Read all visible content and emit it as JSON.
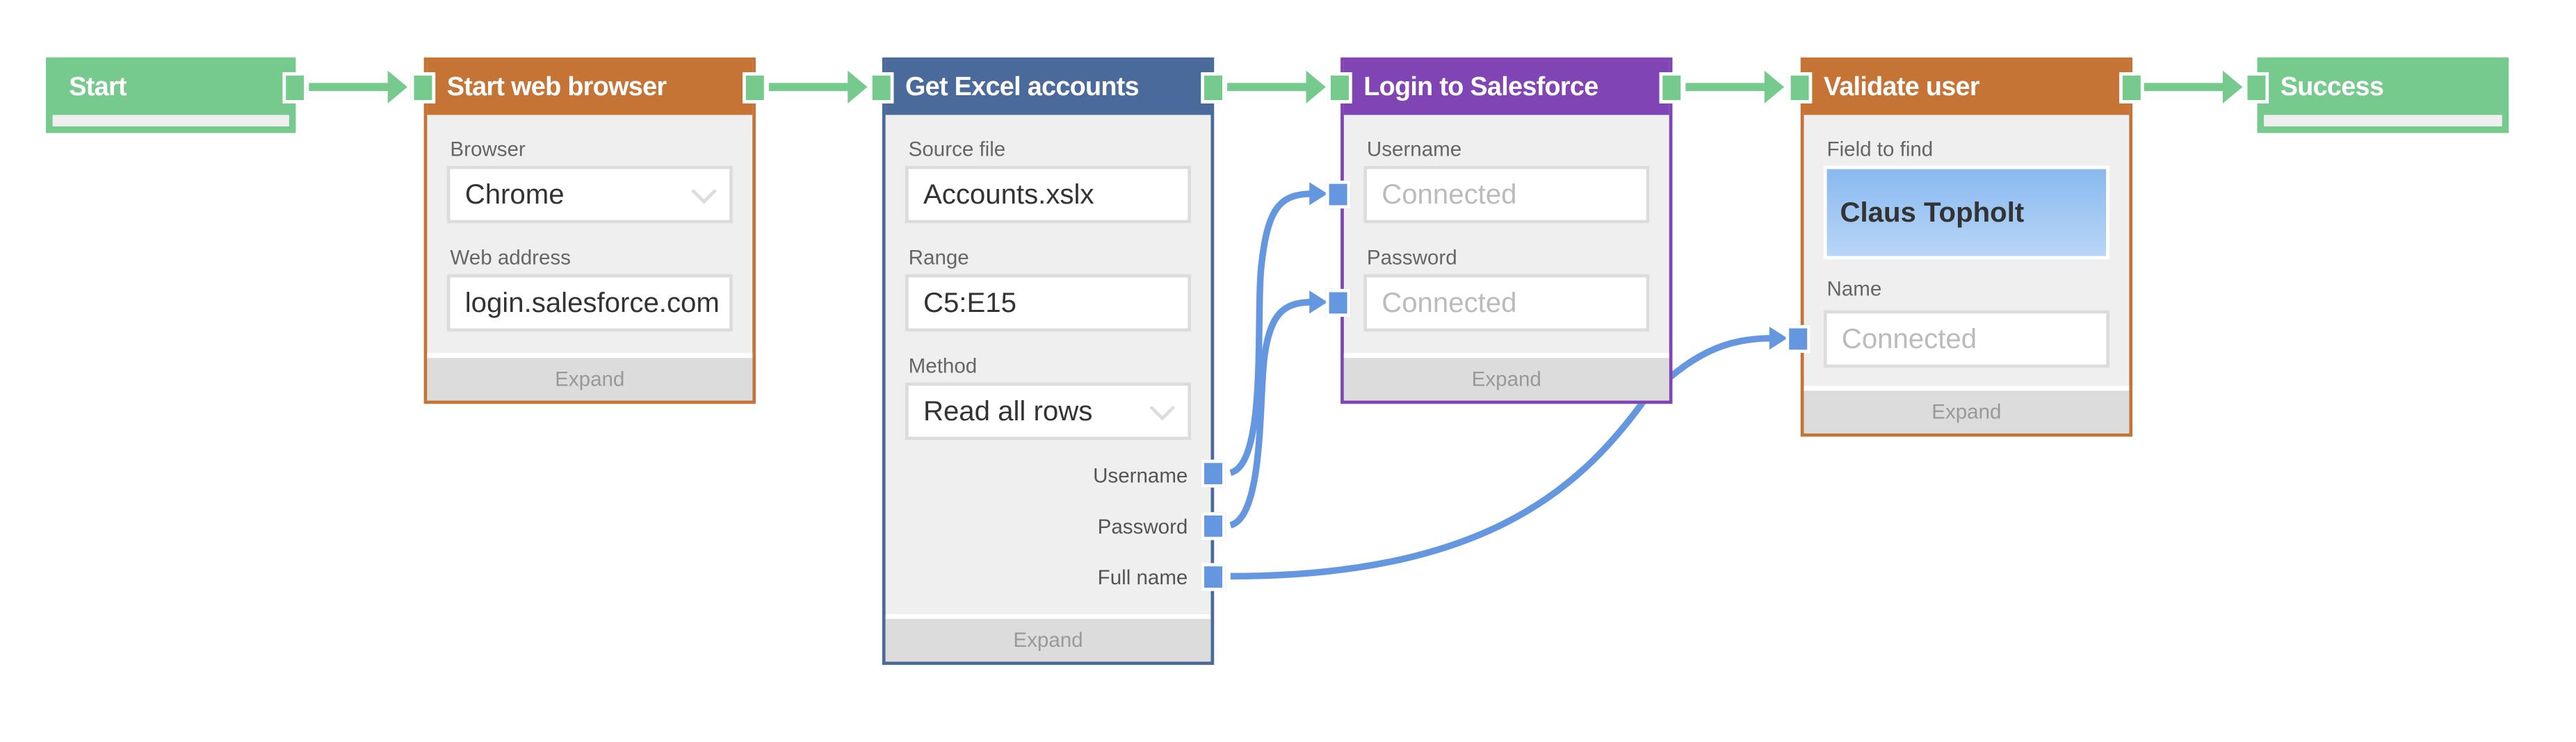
{
  "colors": {
    "flow": "#77ca8e",
    "data": "#6497e0",
    "browser": "#c67336",
    "excel": "#4a6a9c",
    "salesforce": "#8044b4",
    "validate": "#c67336"
  },
  "nodes": {
    "start": {
      "title": "Start"
    },
    "browser": {
      "title": "Start web browser",
      "browser_label": "Browser",
      "browser_value": "Chrome",
      "address_label": "Web address",
      "address_value": "login.salesforce.com",
      "expand": "Expand"
    },
    "excel": {
      "title": "Get Excel accounts",
      "source_label": "Source file",
      "source_value": "Accounts.xslx",
      "range_label": "Range",
      "range_value": "C5:E15",
      "method_label": "Method",
      "method_value": "Read all rows",
      "outputs": [
        "Username",
        "Password",
        "Full name"
      ],
      "expand": "Expand"
    },
    "login": {
      "title": "Login to Salesforce",
      "username_label": "Username",
      "username_value": "Connected",
      "password_label": "Password",
      "password_value": "Connected",
      "expand": "Expand"
    },
    "validate": {
      "title": "Validate user",
      "field_label": "Field to find",
      "field_value": "Claus Topholt",
      "name_label": "Name",
      "name_value": "Connected",
      "expand": "Expand"
    },
    "success": {
      "title": "Success"
    }
  }
}
